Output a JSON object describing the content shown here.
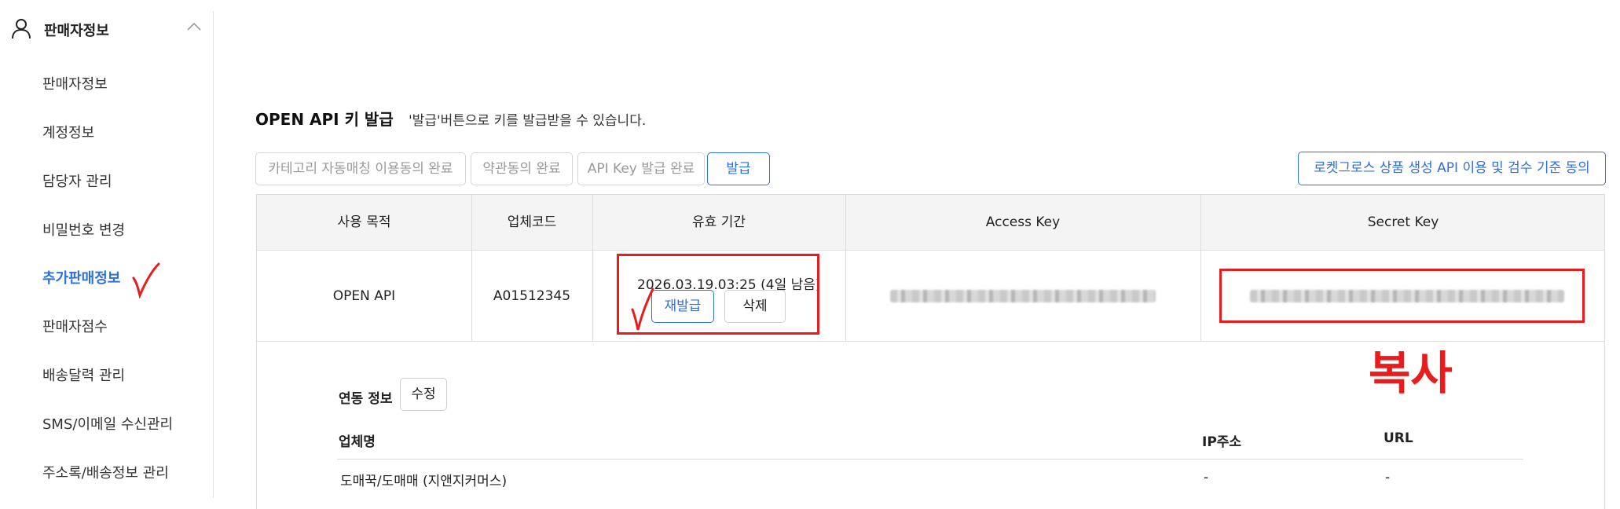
{
  "sidebar": {
    "title": "판매자정보",
    "items": [
      {
        "label": "판매자정보"
      },
      {
        "label": "계정정보"
      },
      {
        "label": "담당자 관리"
      },
      {
        "label": "비밀번호 변경"
      },
      {
        "label": "추가판매정보",
        "active": true
      },
      {
        "label": "판매자점수"
      },
      {
        "label": "배송달력 관리"
      },
      {
        "label": "SMS/이메일 수신관리"
      },
      {
        "label": "주소록/배송정보 관리"
      }
    ]
  },
  "api_section": {
    "title": "OPEN API 키 발급",
    "description": "'발급'버튼으로 키를 발급받을 수 있습니다.",
    "steps": [
      "카테고리 자동매칭 이용동의 완료",
      "약관동의 완료",
      "API Key 발급 완료"
    ],
    "issue_button": "발급",
    "rocket_consent_button": "로켓그로스 상품 생성 API 이용 및 검수 기준 동의"
  },
  "key_table": {
    "headers": [
      "사용 목적",
      "업체코드",
      "유효 기간",
      "Access Key",
      "Secret Key"
    ],
    "row": {
      "purpose": "OPEN API",
      "vendor_code": "A01512345",
      "expiry": "2026.03.19.03:25 (4일 남음)",
      "reissue_button": "재발급",
      "delete_button": "삭제"
    }
  },
  "integration": {
    "label": "연동 정보",
    "edit_button": "수정",
    "columns": [
      "업체명",
      "IP주소",
      "URL"
    ],
    "rows": [
      {
        "company": "도매꾹/도매매 (지앤지커머스)",
        "ip": "-",
        "url": "-"
      }
    ]
  },
  "annotation": {
    "copy_text": "복사",
    "color": "#e81c1c"
  },
  "colors": {
    "accent": "#2f6fe0",
    "annotation_red": "#e81c1c",
    "header_bg": "#f4f4f4"
  }
}
